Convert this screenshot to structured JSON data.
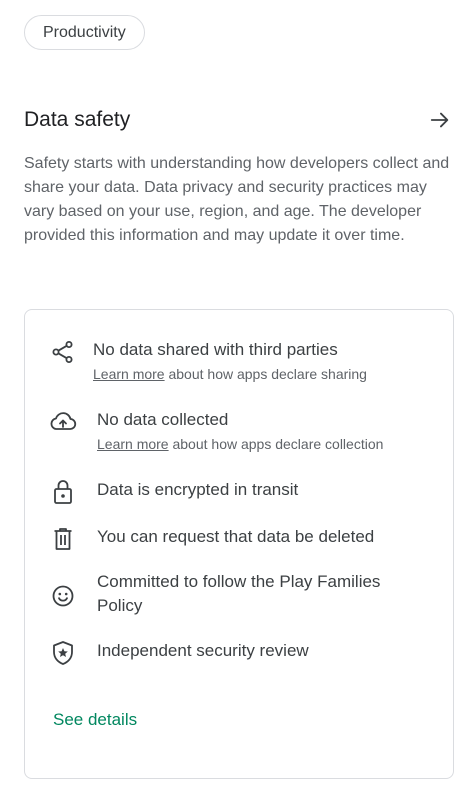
{
  "chip": {
    "label": "Productivity"
  },
  "section": {
    "title": "Data safety",
    "description": "Safety starts with understanding how developers collect and share your data. Data privacy and security practices may vary based on your use, region, and age. The developer provided this information and may update it over time."
  },
  "items": [
    {
      "icon": "share-icon",
      "title": "No data shared with third parties",
      "link": "Learn more",
      "sub": " about how apps declare sharing"
    },
    {
      "icon": "cloud-upload-icon",
      "title": "No data collected",
      "link": "Learn more",
      "sub": " about how apps declare collection"
    },
    {
      "icon": "lock-icon",
      "title": "Data is encrypted in transit"
    },
    {
      "icon": "trash-icon",
      "title": "You can request that data be deleted"
    },
    {
      "icon": "smiley-icon",
      "title": "Committed to follow the Play Families Policy"
    },
    {
      "icon": "shield-star-icon",
      "title": "Independent security review"
    }
  ],
  "see_details": "See details",
  "colors": {
    "accent": "#01875f",
    "text": "#202124",
    "secondary": "#5f6368",
    "border": "#dadce0"
  }
}
